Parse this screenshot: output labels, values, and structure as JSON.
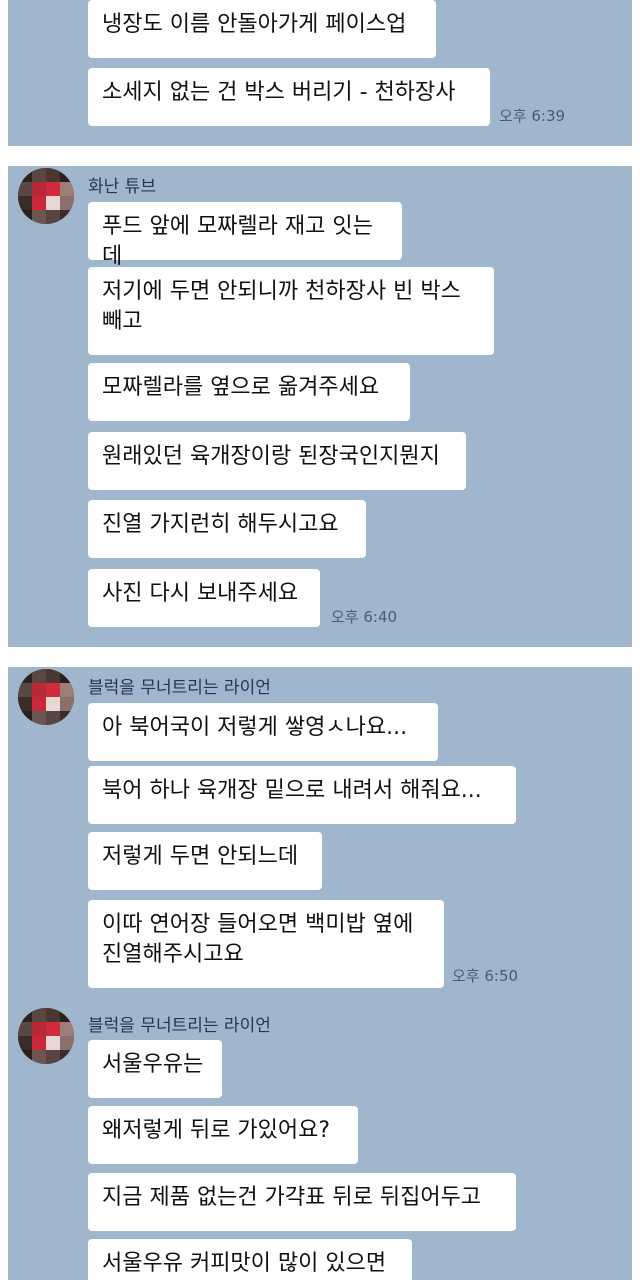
{
  "panel1": {
    "messages": [
      "냉장도 이름 안돌아가게 페이스업",
      "소세지 없는 건 박스 버리기 - 천하장사"
    ],
    "time": "오후 6:39"
  },
  "panel2": {
    "sender": "화난 튜브",
    "messages": [
      "푸드 앞에 모짜렐라 재고 잇는데",
      "저기에 두면 안되니까 천하장사 빈 박스\n빼고",
      "모짜렐라를 옆으로 옮겨주세요",
      "원래있던 육개장이랑 된장국인지뭔지",
      "진열 가지런히 해두시고요",
      "사진 다시 보내주세요"
    ],
    "time": "오후 6:40"
  },
  "panel3": {
    "group1": {
      "sender": "블럭을 무너트리는 라이언",
      "messages": [
        "아 북어국이 저렇게 쌓영ㅅ나요...",
        "북어 하나 육개장 밑으로 내려서 해줘요...",
        "저렇게 두면 안되느데",
        "이따 연어장 들어오면 백미밥 옆에\n진열해주시고요"
      ],
      "time": "오후 6:50"
    },
    "group2": {
      "sender": "블럭을 무너트리는 라이언",
      "messages": [
        "서울우유는",
        "왜저렇게 뒤로 가있어요?",
        "지금 제품 없는건 가갹표 뒤로 뒤집어두고",
        "서울우유 커피맛이 많이 있으면"
      ]
    }
  },
  "colors": {
    "chat_background": "#9fb6cd",
    "bubble": "#ffffff",
    "avatar_accent": "#c8283a"
  }
}
